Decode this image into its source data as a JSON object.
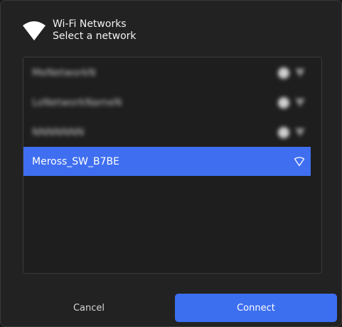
{
  "header": {
    "title": "Wi-Fi Networks",
    "subtitle": "Select a network",
    "icon": "wifi-icon"
  },
  "networks": [
    {
      "ssid": "",
      "blurred": true,
      "secured": true,
      "signal_icon": "wifi-signal-icon"
    },
    {
      "ssid": "",
      "blurred": true,
      "secured": true,
      "signal_icon": "wifi-signal-icon"
    },
    {
      "ssid": "",
      "blurred": true,
      "secured": true,
      "signal_icon": "wifi-signal-icon"
    },
    {
      "ssid": "Meross_SW_B7BE",
      "blurred": false,
      "selected": true,
      "secured": false,
      "signal_icon": "wifi-signal-icon"
    }
  ],
  "buttons": {
    "cancel_label": "Cancel",
    "connect_label": "Connect"
  },
  "colors": {
    "accent": "#3c6ef0",
    "selected_row": "#3f6ff0",
    "background": "#222222"
  }
}
